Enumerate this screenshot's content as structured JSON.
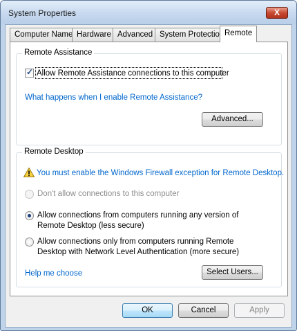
{
  "window": {
    "title": "System Properties",
    "close_glyph": "X"
  },
  "tabs": [
    {
      "label": "Computer Name"
    },
    {
      "label": "Hardware"
    },
    {
      "label": "Advanced"
    },
    {
      "label": "System Protection"
    },
    {
      "label": "Remote",
      "active": true
    }
  ],
  "remote_assistance": {
    "group_label": "Remote Assistance",
    "allow_checkbox_label": "Allow Remote Assistance connections to this computer",
    "allow_checked": true,
    "help_link": "What happens when I enable Remote Assistance?",
    "advanced_button": "Advanced..."
  },
  "remote_desktop": {
    "group_label": "Remote Desktop",
    "warning_link": "You must enable the Windows Firewall exception for Remote Desktop.",
    "warning_icon": "warning-icon",
    "options": [
      {
        "line1": "Don't allow connections to this computer",
        "line2": "",
        "selected": false,
        "disabled": true
      },
      {
        "line1": "Allow connections from computers running any version of",
        "line2": "Remote Desktop (less secure)",
        "selected": true,
        "disabled": false
      },
      {
        "line1": "Allow connections only from computers running Remote",
        "line2": "Desktop with Network Level Authentication (more secure)",
        "selected": false,
        "disabled": false
      }
    ],
    "help_link": "Help me choose",
    "select_users_button": "Select Users..."
  },
  "footer": {
    "ok": "OK",
    "cancel": "Cancel",
    "apply": "Apply"
  }
}
